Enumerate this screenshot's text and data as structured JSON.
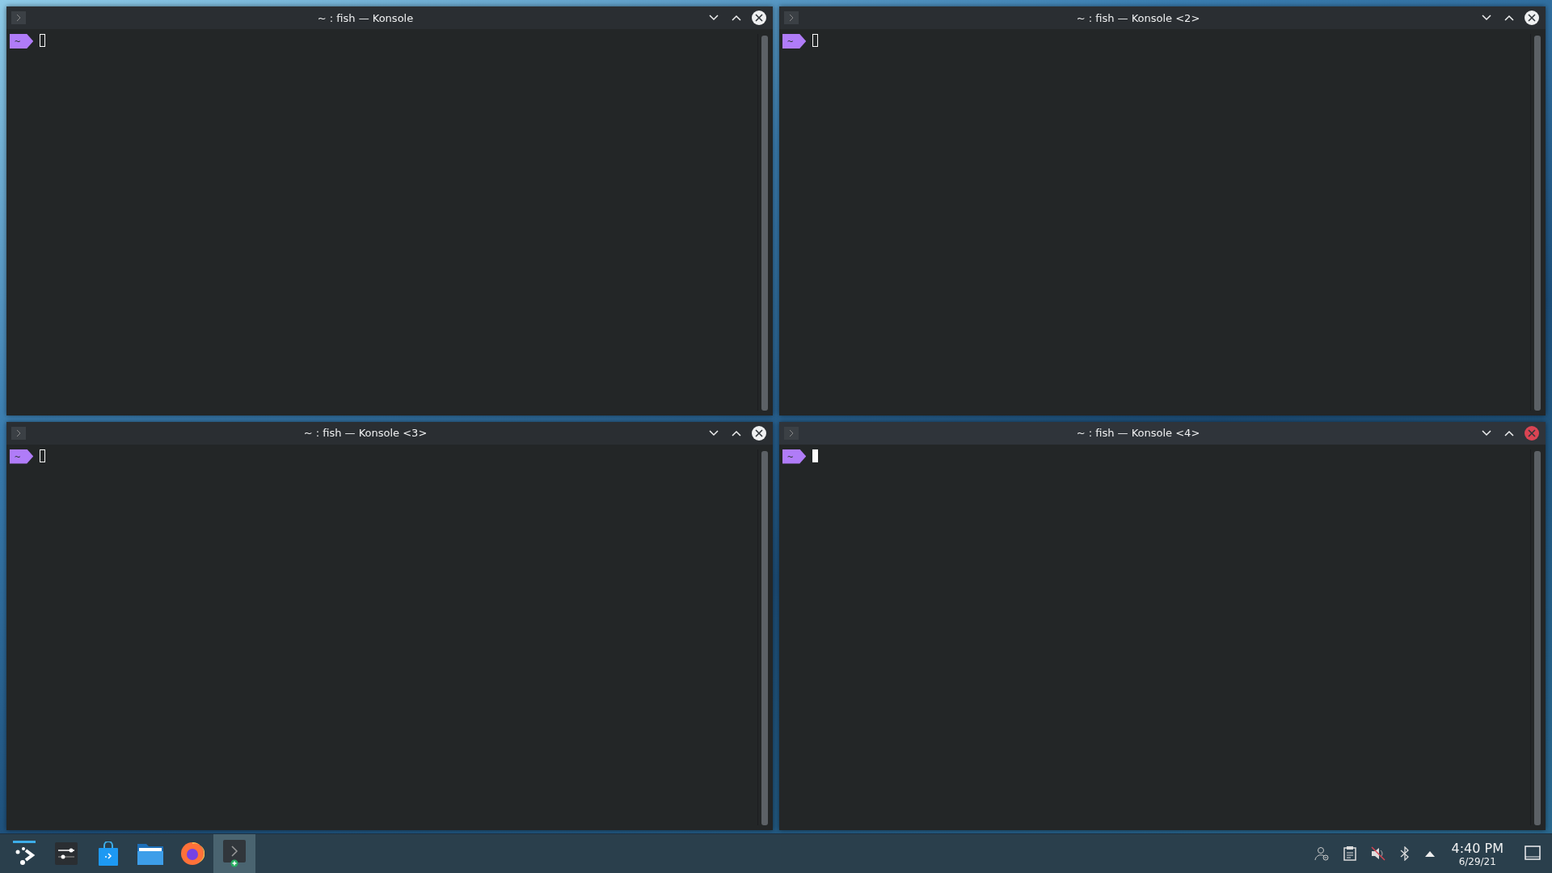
{
  "windows": [
    {
      "title": "~ : fish — Konsole",
      "active": false,
      "prompt": "~"
    },
    {
      "title": "~ : fish — Konsole <2>",
      "active": false,
      "prompt": "~"
    },
    {
      "title": "~ : fish — Konsole <3>",
      "active": false,
      "prompt": "~"
    },
    {
      "title": "~ : fish — Konsole <4>",
      "active": true,
      "prompt": "~"
    }
  ],
  "taskbar": {
    "tasks": [
      {
        "kind": "launcher",
        "selected": false
      },
      {
        "kind": "settings",
        "selected": false
      },
      {
        "kind": "store",
        "selected": false
      },
      {
        "kind": "files",
        "selected": false
      },
      {
        "kind": "browser",
        "selected": false
      },
      {
        "kind": "terminal",
        "selected": true
      }
    ],
    "tray": [
      {
        "kind": "user"
      },
      {
        "kind": "clipboard"
      },
      {
        "kind": "muted"
      },
      {
        "kind": "bluetooth"
      },
      {
        "kind": "expand"
      }
    ],
    "clock": {
      "time": "4:40 PM",
      "date": "6/29/21"
    }
  }
}
